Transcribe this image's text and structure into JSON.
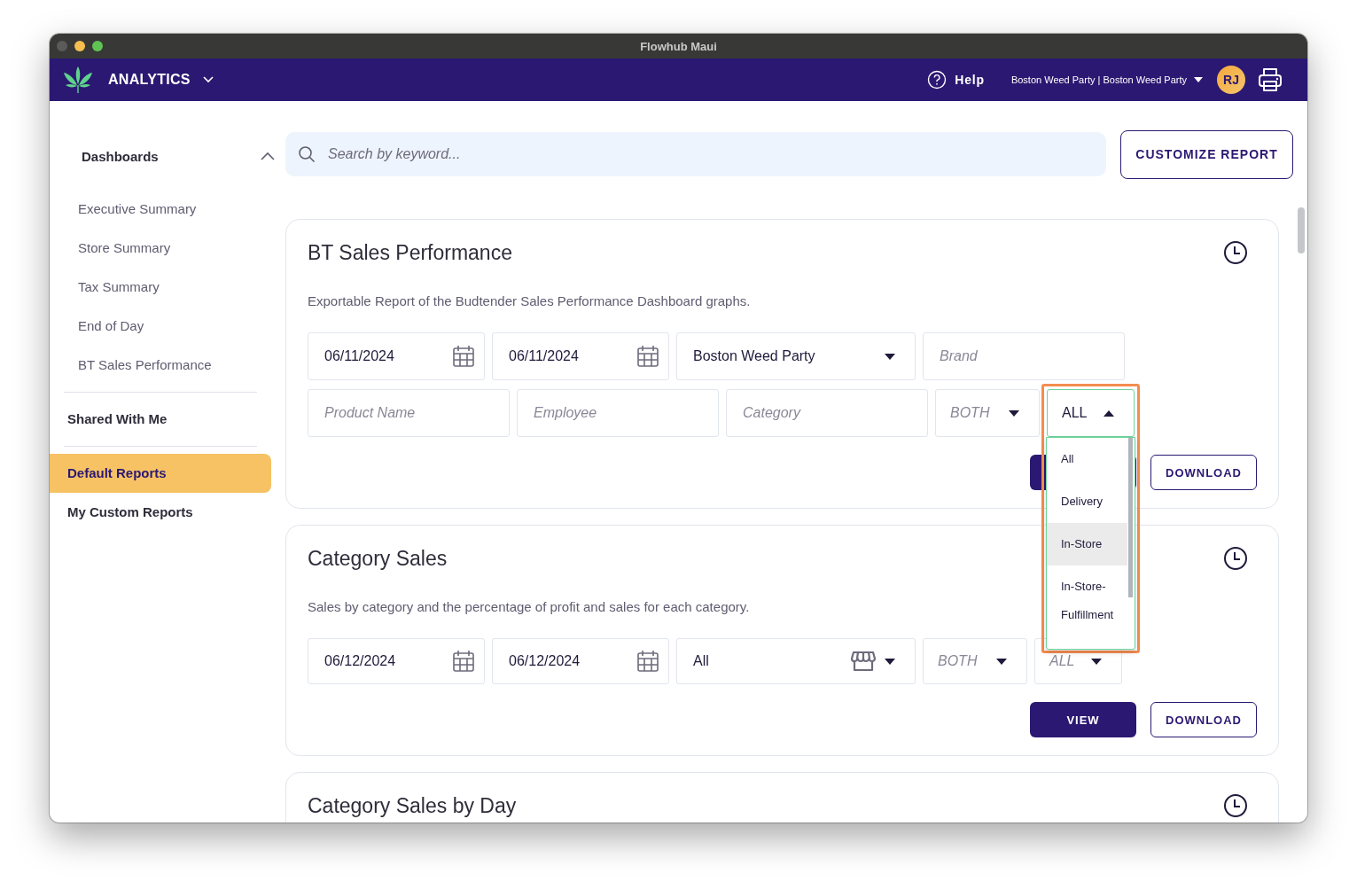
{
  "window": {
    "title": "Flowhub Maui"
  },
  "navbar": {
    "app": "ANALYTICS",
    "help": "Help",
    "location": "Boston Weed Party | Boston Weed Party",
    "avatar": "RJ"
  },
  "sidebar": {
    "groups": [
      {
        "label": "Dashboards",
        "expanded": true,
        "items": [
          {
            "label": "Executive Summary",
            "selected": false
          },
          {
            "label": "Store Summary",
            "selected": false
          },
          {
            "label": "Tax Summary",
            "selected": false
          },
          {
            "label": "End of Day",
            "selected": false
          },
          {
            "label": "BT Sales Performance",
            "selected": false
          }
        ]
      }
    ],
    "links": [
      {
        "label": "Shared With Me",
        "selected": false
      },
      {
        "label": "Default Reports",
        "selected": true
      },
      {
        "label": "My Custom Reports",
        "selected": false
      }
    ]
  },
  "search": {
    "placeholder": "Search by keyword..."
  },
  "customize_button": "CUSTOMIZE REPORT",
  "reports": [
    {
      "title": "BT Sales Performance",
      "description": "Exportable Report of the Budtender Sales Performance Dashboard graphs.",
      "filters": [
        {
          "kind": "date",
          "value": "06/11/2024"
        },
        {
          "kind": "date",
          "value": "06/11/2024"
        },
        {
          "kind": "location",
          "value": "Boston Weed Party"
        },
        {
          "kind": "text",
          "placeholder": "Brand"
        },
        {
          "kind": "text",
          "placeholder": "Product Name"
        },
        {
          "kind": "text",
          "placeholder": "Employee"
        },
        {
          "kind": "text",
          "placeholder": "Category"
        },
        {
          "kind": "mode",
          "placeholder": "BOTH"
        },
        {
          "kind": "channel",
          "value": "ALL",
          "open": true,
          "framed": true,
          "options": [
            {
              "label": "All",
              "highlighted": false
            },
            {
              "label": "Delivery",
              "highlighted": false
            },
            {
              "label": "In-Store",
              "highlighted": true
            },
            {
              "label": "In-Store-Fulfillment",
              "highlighted": false
            }
          ]
        }
      ],
      "buttons": [
        {
          "kind": "view"
        },
        {
          "kind": "download",
          "label": "DOWNLOAD"
        }
      ]
    },
    {
      "title": "Category Sales",
      "description": "Sales by category and the percentage of profit and sales for each category.",
      "filters": [
        {
          "kind": "date",
          "value": "06/12/2024"
        },
        {
          "kind": "date",
          "value": "06/12/2024"
        },
        {
          "kind": "store",
          "value": "All"
        },
        {
          "kind": "mode",
          "placeholder": "BOTH"
        },
        {
          "kind": "channel",
          "placeholder": "ALL"
        }
      ],
      "buttons": [
        {
          "kind": "view",
          "label": "VIEW"
        },
        {
          "kind": "download",
          "label": "DOWNLOAD"
        }
      ]
    },
    {
      "title": "Category Sales by Day"
    }
  ]
}
